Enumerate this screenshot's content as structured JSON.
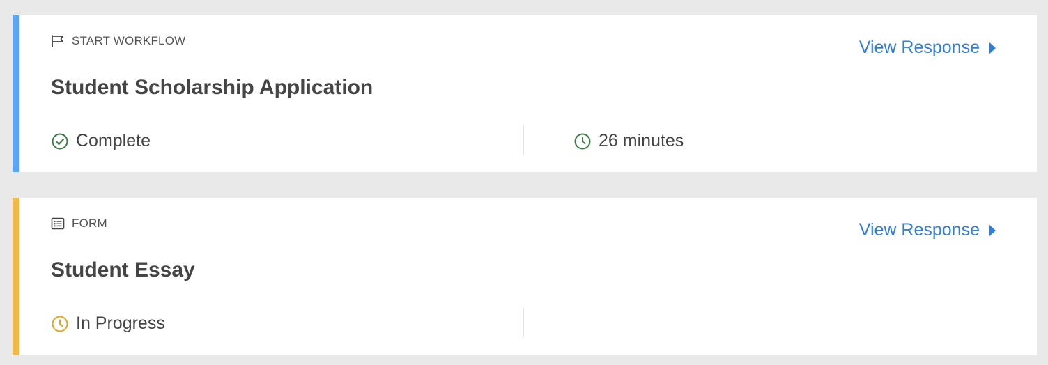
{
  "cards": [
    {
      "type_label": "START WORKFLOW",
      "type_icon": "flag-icon",
      "title": "Student Scholarship Application",
      "link_label": "View Response",
      "status": "Complete",
      "status_icon": "check-circle-icon",
      "duration": "26 minutes",
      "duration_icon": "clock-icon",
      "accent_color": "#5ba3f5",
      "status_color": "#3a7d44"
    },
    {
      "type_label": "FORM",
      "type_icon": "form-list-icon",
      "title": "Student Essay",
      "link_label": "View Response",
      "status": "In Progress",
      "status_icon": "clock-icon",
      "accent_color": "#f2b94a",
      "status_color": "#e3a520"
    }
  ],
  "colors": {
    "link": "#2f7fd9",
    "background": "#e9e9e9"
  }
}
